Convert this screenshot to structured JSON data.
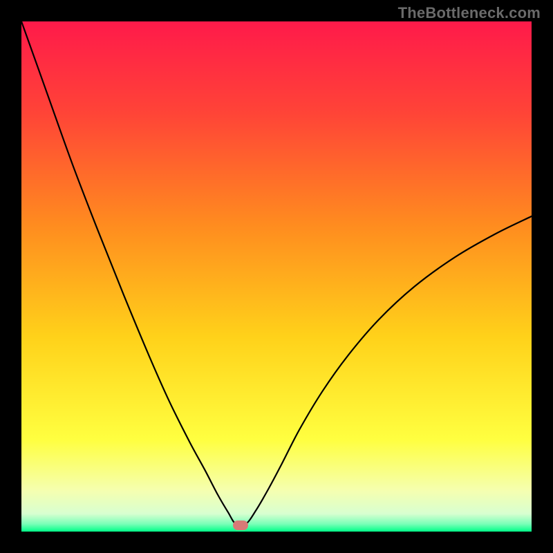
{
  "watermark": "TheBottleneck.com",
  "marker": {
    "style_color": "#d77a77",
    "x_frac": 0.429,
    "y_frac": 0.988
  },
  "chart_data": {
    "type": "line",
    "title": "",
    "xlabel": "",
    "ylabel": "",
    "xlim": [
      0,
      1
    ],
    "ylim": [
      0,
      100
    ],
    "background": {
      "type": "vertical-gradient",
      "stops": [
        {
          "pos": 0.0,
          "color": "#ff1a4a"
        },
        {
          "pos": 0.18,
          "color": "#ff4437"
        },
        {
          "pos": 0.4,
          "color": "#ff8c1f"
        },
        {
          "pos": 0.62,
          "color": "#ffd21a"
        },
        {
          "pos": 0.82,
          "color": "#ffff40"
        },
        {
          "pos": 0.92,
          "color": "#f5ffb0"
        },
        {
          "pos": 0.965,
          "color": "#d8ffd0"
        },
        {
          "pos": 0.985,
          "color": "#7affb8"
        },
        {
          "pos": 1.0,
          "color": "#00ff88"
        }
      ]
    },
    "series": [
      {
        "name": "bottleneck-curve",
        "color": "#000000",
        "x": [
          0.0,
          0.05,
          0.1,
          0.15,
          0.2,
          0.25,
          0.29,
          0.33,
          0.36,
          0.385,
          0.405,
          0.42,
          0.44,
          0.46,
          0.485,
          0.51,
          0.545,
          0.59,
          0.64,
          0.7,
          0.77,
          0.85,
          0.93,
          1.0
        ],
        "values": [
          100.0,
          86.0,
          72.0,
          59.0,
          46.5,
          34.5,
          25.5,
          17.5,
          12.0,
          7.2,
          3.8,
          1.5,
          1.5,
          4.2,
          8.5,
          13.2,
          20.0,
          27.5,
          34.5,
          41.5,
          48.0,
          53.8,
          58.4,
          61.8
        ]
      }
    ],
    "marker_point": {
      "x": 0.429,
      "bottleneck_pct": 1.2
    }
  }
}
